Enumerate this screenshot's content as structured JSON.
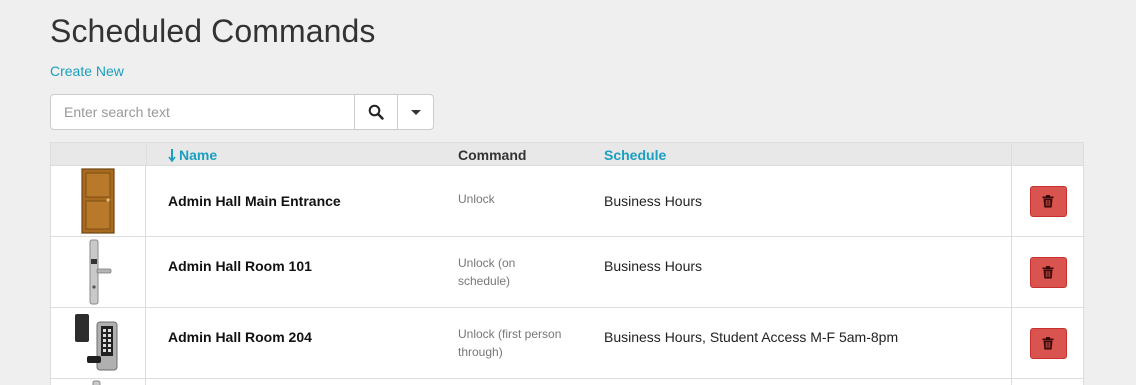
{
  "page": {
    "title": "Scheduled Commands",
    "create_link": "Create New"
  },
  "search": {
    "placeholder": "Enter search text",
    "value": ""
  },
  "table": {
    "columns": {
      "name": "Name",
      "command": "Command",
      "schedule": "Schedule"
    },
    "sort": {
      "column": "name",
      "direction": "descending-arrow"
    },
    "rows": [
      {
        "name": "Admin Hall Main Entrance",
        "command": "Unlock",
        "schedule": "Business Hours",
        "image": "door-icon"
      },
      {
        "name": "Admin Hall Room 101",
        "command": "Unlock (on schedule)",
        "schedule": "Business Hours",
        "image": "lever-lock-icon"
      },
      {
        "name": "Admin Hall Room 204",
        "command": "Unlock (first person through)",
        "schedule": "Business Hours, Student Access M-F 5am-8pm",
        "image": "keypad-lock-icon"
      }
    ]
  },
  "colors": {
    "link": "#1a9fc0",
    "danger": "#d9534f",
    "background": "#efefef",
    "header_bg": "#e8e8e8"
  }
}
